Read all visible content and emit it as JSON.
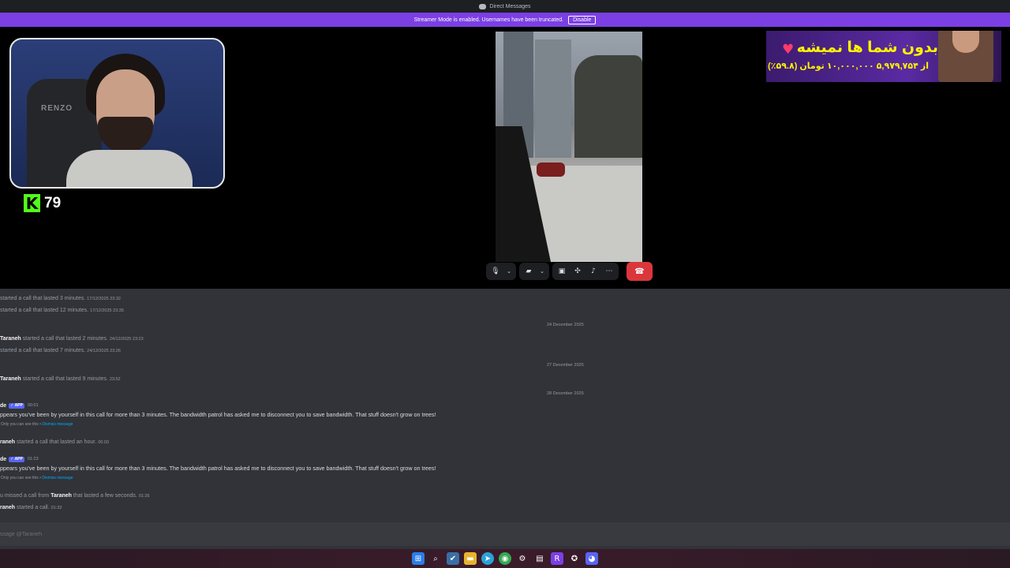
{
  "window": {
    "title": "Direct Messages"
  },
  "banner": {
    "text": "Streamer Mode is enabled. Usernames have been truncated.",
    "disable_label": "Disable"
  },
  "webcam": {
    "chair_text": "RENZO"
  },
  "kick": {
    "count": "79",
    "icon_letter": "K",
    "color": "#53fc18"
  },
  "ad": {
    "title": "بدون شما ها نمیشه",
    "subtitle": "از ۵,۹۷۹,۷۵۴ ۱۰,۰۰۰,۰۰۰ تومان (۵۹.۸٪)"
  },
  "controls": {
    "mic_icon": "microphone-icon",
    "camera_icon": "camera-off-icon",
    "screenshare_icon": "screen-share-icon",
    "activities_icon": "activities-icon",
    "soundboard_icon": "soundboard-icon",
    "more_icon": "more-icon",
    "hangup_icon": "hang-up-icon",
    "hangup_color": "#da373c"
  },
  "chat": {
    "events": [
      {
        "text": "started a call that lasted 3 minutes.",
        "time": "17/12/2025 23:32"
      },
      {
        "text": "started a call that lasted 12 minutes.",
        "time": "17/12/2025 23:35"
      },
      {
        "author": "Taraneh",
        "text": "started a call that lasted 2 minutes.",
        "time": "24/12/2025 23:23"
      },
      {
        "text": "started a call that lasted 7 minutes.",
        "time": "24/12/2025 23:26"
      },
      {
        "author": "Taraneh",
        "text": "started a call that lasted 9 minutes.",
        "time": "23:52"
      },
      {
        "author": "raneh",
        "text": "started a call that lasted an hour.",
        "time": "00:03"
      },
      {
        "prefix": "u missed a call from",
        "author": "Taraneh",
        "text": "that lasted a few seconds.",
        "time": "01:26"
      },
      {
        "author": "raneh",
        "text": "started a call.",
        "time": "01:32"
      }
    ],
    "dividers": [
      "24 December 2025",
      "27 December 2025",
      "28 December 2025"
    ],
    "bot_messages": [
      {
        "author": "de",
        "tag": "✓ APP",
        "time": "00:01",
        "body": "ppears you've been by yourself in this call for more than 3 minutes. The bandwidth patrol has asked me to disconnect you to save bandwidth. That stuff doesn't grow on trees!",
        "ephemeral": "Only you can see this •",
        "dismiss": "Dismiss message"
      },
      {
        "author": "de",
        "tag": "✓ APP",
        "time": "01:23",
        "body": "ppears you've been by yourself in this call for more than 3 minutes. The bandwidth patrol has asked me to disconnect you to save bandwidth. That stuff doesn't grow on trees!",
        "ephemeral": "Only you can see this •",
        "dismiss": "Dismiss message"
      }
    ],
    "composer_placeholder": "ssage @Taraneh"
  },
  "taskbar": {
    "icons": [
      "windows-start-icon",
      "search-icon",
      "app-icon",
      "file-explorer-icon",
      "telegram-icon",
      "chrome-icon",
      "settings-icon",
      "app-icon-2",
      "rider-icon",
      "app-icon-3",
      "discord-icon"
    ]
  },
  "colors": {
    "accent": "#7b3fe4",
    "chat_bg": "#313338",
    "app_tag": "#5865f2"
  }
}
